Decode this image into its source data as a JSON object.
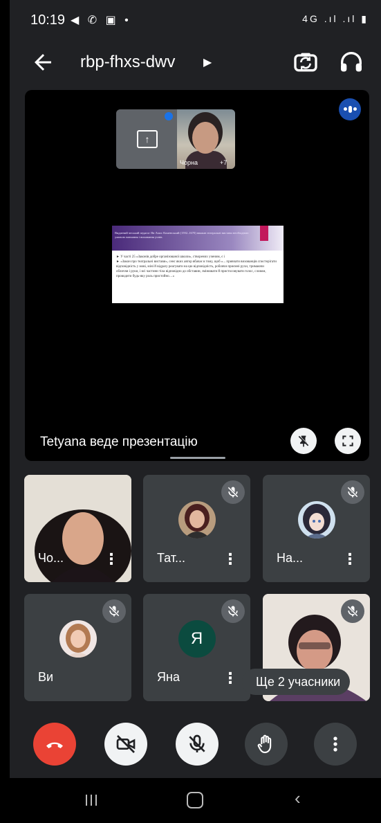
{
  "status_bar": {
    "time": "10:19",
    "left_icons": "◀ ✆ ▣ •",
    "right_icons": "4G .ıl .ıl ▮"
  },
  "header": {
    "meeting_code": "rbp-fhxs-dwv",
    "back_icon": "arrow-left-icon",
    "flip_icon": "flip-camera-icon",
    "audio_icon": "headphones-icon"
  },
  "stage": {
    "mini_tile_name": "Чорна",
    "mini_tile_more": "+7",
    "slide_heading": "Видатний чеський педагог Ян Амос Коменський (1592–1670) вважав театральні вистави необхідною умовою навчання і виховання учнів.",
    "slide_bullet_1": "► У часті 25 «Законів добре організованої школи», створених ученим, є і",
    "slide_bullet_2": "► «Закон про театральні вистави», сенс яких автор вбачає в тому, щоб «... привчати вихованців спостерігати відповідність у мові, міні й відразу реагувати на цю відповідність, роблячи приємні рухи, тримаючи обличчя і руки, і всі частини тіла відповідно до обставин, змінювати й пристосовувати голос, словом, проводити будь-яку роль пристойно…»",
    "presenting_text": "Tetyana веде презентацію"
  },
  "participants": [
    {
      "name": "Чо...",
      "type": "video"
    },
    {
      "name": "Тат...",
      "type": "avatar"
    },
    {
      "name": "На...",
      "type": "avatar"
    },
    {
      "name": "Ви",
      "type": "avatar"
    },
    {
      "name": "Яна",
      "type": "letter",
      "initial": "Я"
    },
    {
      "name": "",
      "type": "video"
    }
  ],
  "more_participants": "Ще 2 учасники",
  "colors": {
    "end_call": "#ea4335",
    "background": "#202124",
    "tile": "#3c4043",
    "voice_badge": "#1a4fb0"
  }
}
